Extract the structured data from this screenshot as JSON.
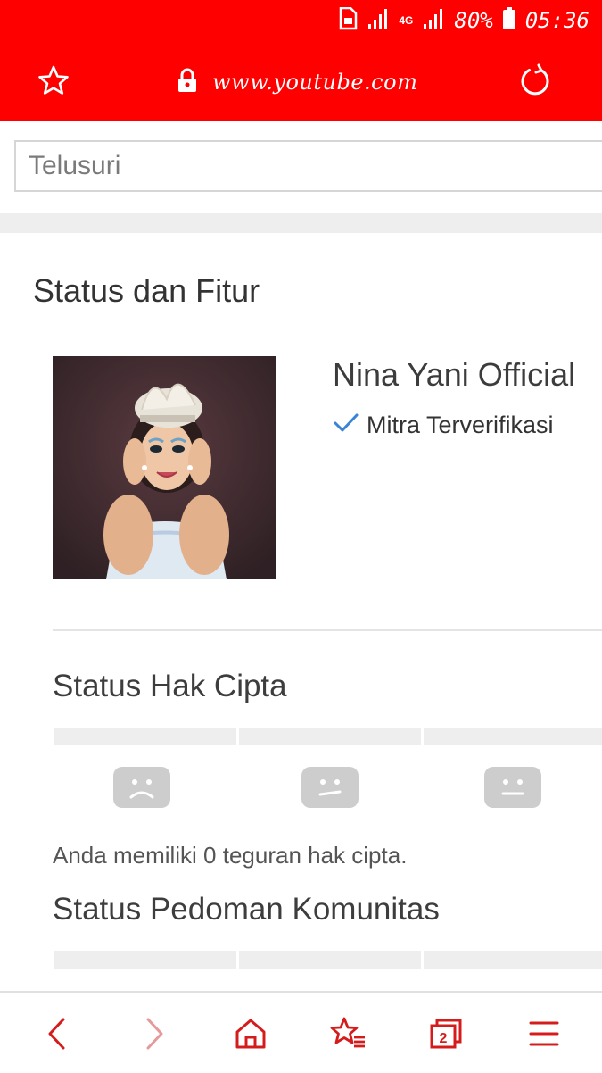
{
  "status_bar": {
    "battery": "80%",
    "time": "05:36",
    "network": "4G"
  },
  "browser": {
    "url": "www.youtube.com"
  },
  "search": {
    "placeholder": "Telusuri"
  },
  "page": {
    "title": "Status dan Fitur",
    "channel_name": "Nina Yani Official",
    "verified_label": "Mitra Terverifikasi"
  },
  "copyright": {
    "title": "Status Hak Cipta",
    "strike_text": "Anda memiliki 0 teguran hak cipta."
  },
  "community": {
    "title": "Status Pedoman Komunitas"
  },
  "colors": {
    "brand": "#ff0000",
    "verified": "#3a84d8"
  },
  "icons": [
    "star-icon",
    "lock-icon",
    "reload-icon",
    "check-icon",
    "sad-face-icon",
    "neutral-face-icon",
    "back-icon",
    "forward-icon",
    "home-icon",
    "bookmarks-icon",
    "tabs-icon",
    "menu-icon"
  ],
  "bottom_nav": {
    "tabs_count": "2"
  }
}
